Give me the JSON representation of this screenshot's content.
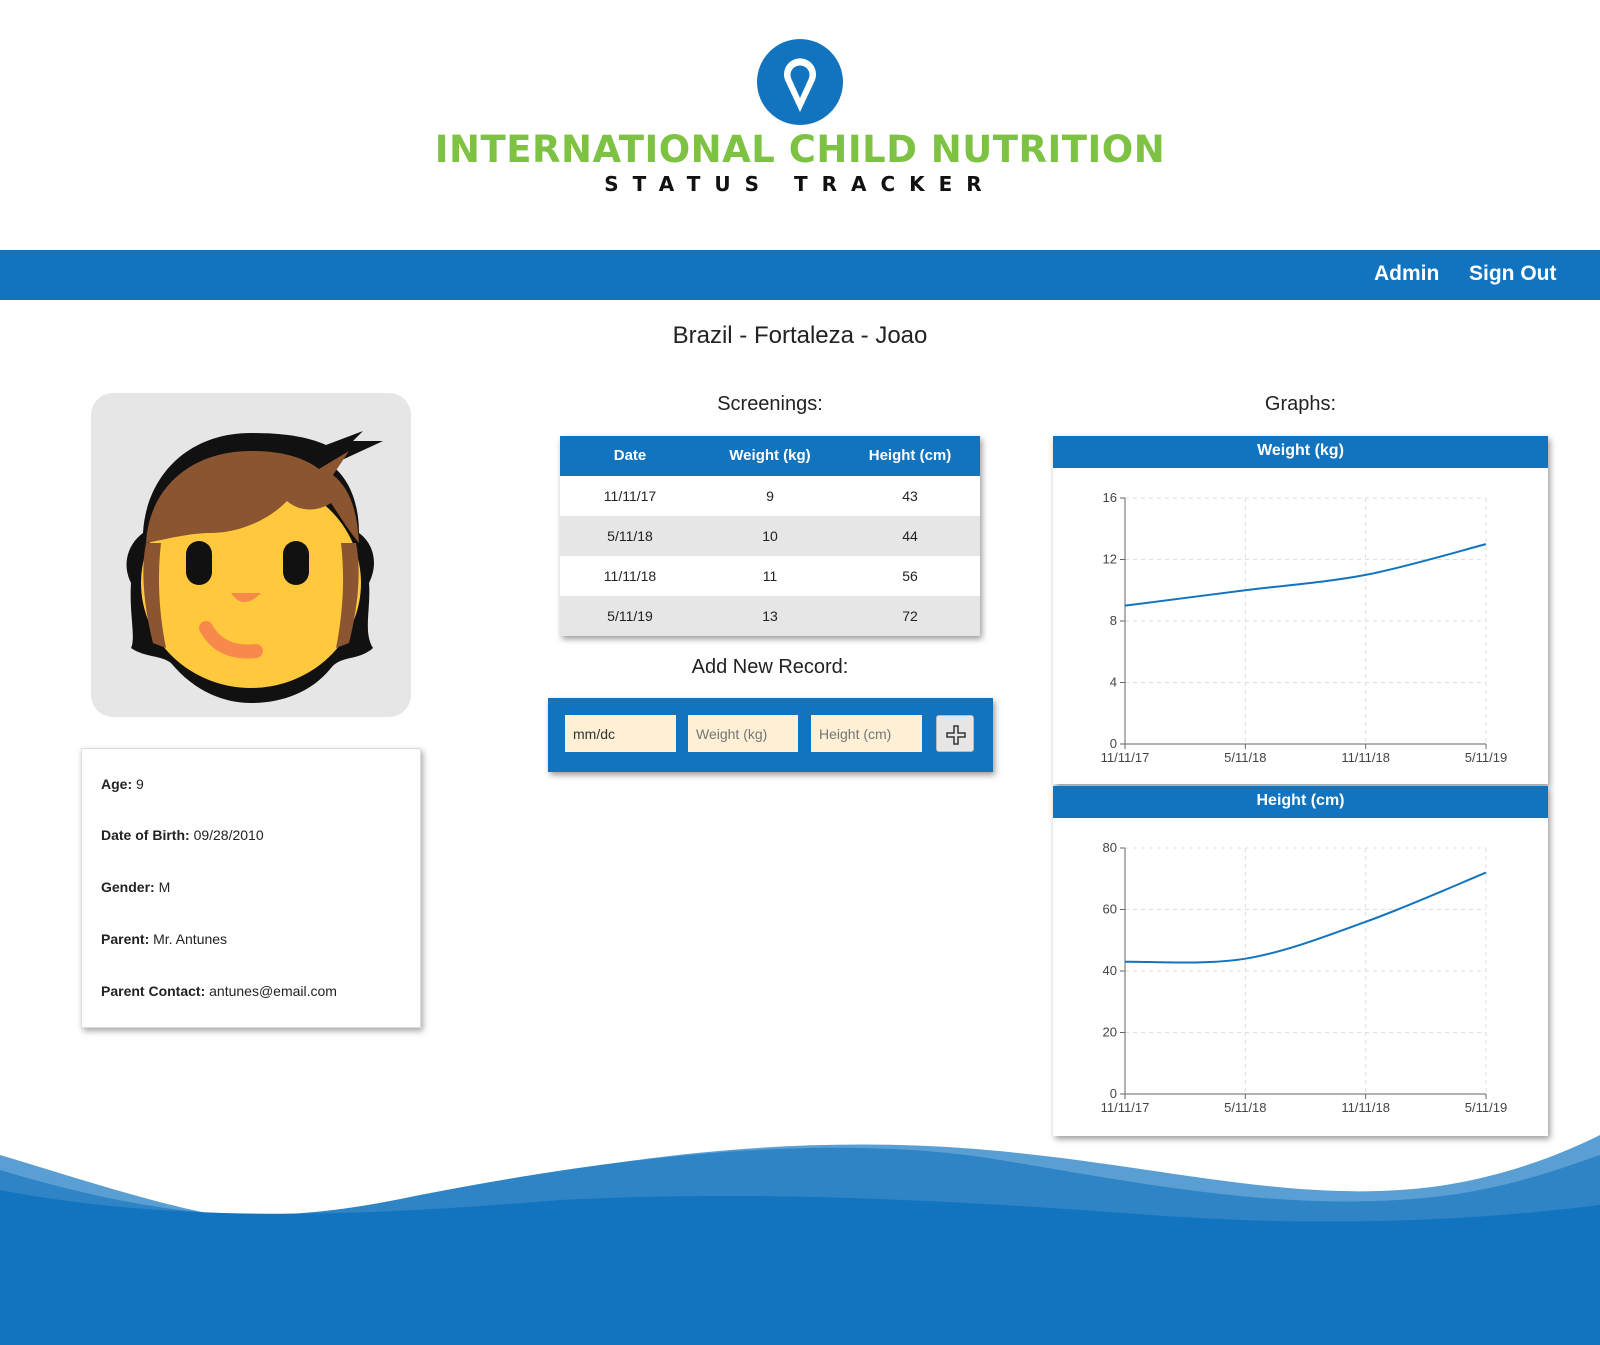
{
  "header": {
    "logo_line1": "INTERNATIONAL CHILD NUTRITION",
    "logo_line2": "STATUS TRACKER"
  },
  "nav": {
    "admin": "Admin",
    "sign_out": "Sign Out"
  },
  "page_title": "Brazil - Fortaleza - Joao",
  "info": {
    "age_label": "Age:",
    "age_value": "9",
    "dob_label": "Date of Birth:",
    "dob_value": "09/28/2010",
    "gender_label": "Gender:",
    "gender_value": "M",
    "parent_label": "Parent:",
    "parent_value": "Mr. Antunes",
    "contact_label": "Parent Contact:",
    "contact_value": "antunes@email.com"
  },
  "screenings": {
    "heading": "Screenings:",
    "columns": [
      "Date",
      "Weight (kg)",
      "Height (cm)"
    ],
    "rows": [
      [
        "11/11/17",
        "9",
        "43"
      ],
      [
        "5/11/18",
        "10",
        "44"
      ],
      [
        "11/11/18",
        "11",
        "56"
      ],
      [
        "5/11/19",
        "13",
        "72"
      ]
    ]
  },
  "add_record": {
    "heading": "Add New Record:",
    "date_value": "mm/dc",
    "weight_placeholder": "Weight (kg)",
    "height_placeholder": "Height (cm)",
    "add_icon": "plus-icon"
  },
  "graphs": {
    "heading": "Graphs:"
  },
  "colors": {
    "brand_blue": "#1274bf",
    "brand_green": "#7dc242",
    "input_bg": "#fdf0d5"
  },
  "chart_data": [
    {
      "type": "line",
      "title": "Weight (kg)",
      "x": [
        "11/11/17",
        "5/11/18",
        "11/11/18",
        "5/11/19"
      ],
      "values": [
        9,
        10,
        11,
        13
      ],
      "ylim": [
        0,
        16
      ],
      "yticks": [
        0,
        4,
        8,
        12,
        16
      ],
      "grid": true
    },
    {
      "type": "line",
      "title": "Height (cm)",
      "x": [
        "11/11/17",
        "5/11/18",
        "11/11/18",
        "5/11/19"
      ],
      "values": [
        43,
        44,
        56,
        72
      ],
      "ylim": [
        0,
        80
      ],
      "yticks": [
        0,
        20,
        40,
        60,
        80
      ],
      "grid": true
    }
  ]
}
